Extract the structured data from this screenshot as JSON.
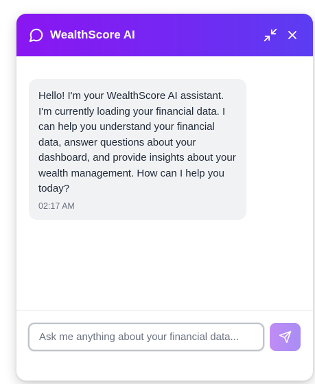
{
  "header": {
    "title": "WealthScore AI",
    "icon": "chat-bubble-icon",
    "minimize_icon": "minimize-icon",
    "close_icon": "close-icon",
    "gradient_start": "#8a16f2",
    "gradient_end": "#5b3df2"
  },
  "messages": [
    {
      "sender": "assistant",
      "text": "Hello! I'm your WealthScore AI assistant. I'm currently loading your financial data. I can help you understand your financial data, answer questions about your dashboard, and provide insights about your wealth management. How can I help you today?",
      "time": "02:17 AM"
    }
  ],
  "composer": {
    "placeholder": "Ask me anything about your financial data...",
    "value": "",
    "send_icon": "send-icon",
    "send_color": "#b48cf5"
  }
}
